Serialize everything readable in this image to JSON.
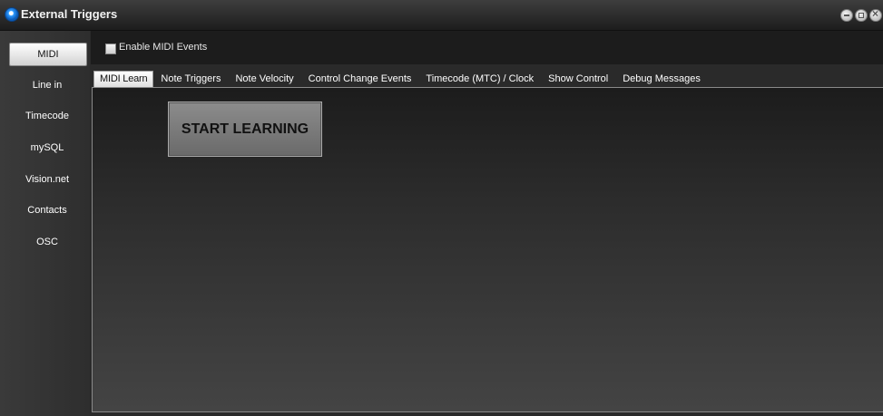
{
  "window": {
    "title": "External Triggers"
  },
  "sidebar": {
    "items": [
      {
        "label": "MIDI",
        "active": true
      },
      {
        "label": "Line in"
      },
      {
        "label": "Timecode"
      },
      {
        "label": "mySQL"
      },
      {
        "label": "Vision.net"
      },
      {
        "label": "Contacts"
      },
      {
        "label": "OSC"
      }
    ]
  },
  "events": {
    "enable_label": "Enable MIDI Events",
    "enabled": false
  },
  "tabs": [
    {
      "label": "MIDI Learn",
      "active": true
    },
    {
      "label": "Note Triggers"
    },
    {
      "label": "Note Velocity"
    },
    {
      "label": "Control Change Events"
    },
    {
      "label": "Timecode (MTC) / Clock"
    },
    {
      "label": "Show Control"
    },
    {
      "label": "Debug Messages"
    }
  ],
  "learn": {
    "button_label": "START LEARNING"
  }
}
